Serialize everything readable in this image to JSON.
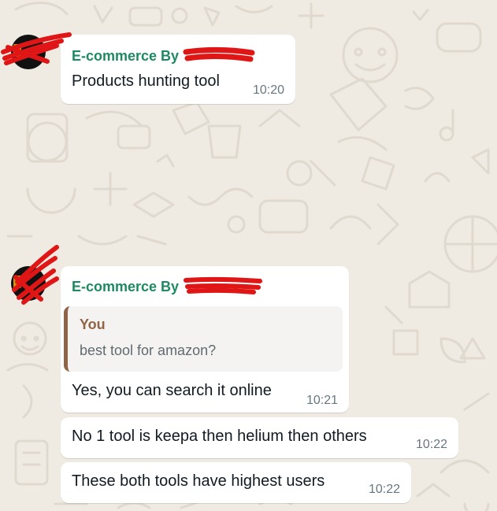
{
  "messages": [
    {
      "sender": "E-commerce By",
      "text": "Products hunting tool",
      "time": "10:20"
    },
    {
      "sender": "E-commerce By",
      "quote": {
        "author": "You",
        "text": "best tool for amazon?"
      },
      "text": "Yes, you can search it online",
      "time": "10:21"
    },
    {
      "text": "No 1 tool is keepa then helium then others",
      "time": "10:22"
    },
    {
      "text": "These both tools have highest users",
      "time": "10:22"
    }
  ],
  "colors": {
    "background": "#efeae2",
    "sender_name": "#1f8a62",
    "quote_accent": "#8f6447",
    "timestamp": "#667781",
    "redaction": "#e01616"
  }
}
